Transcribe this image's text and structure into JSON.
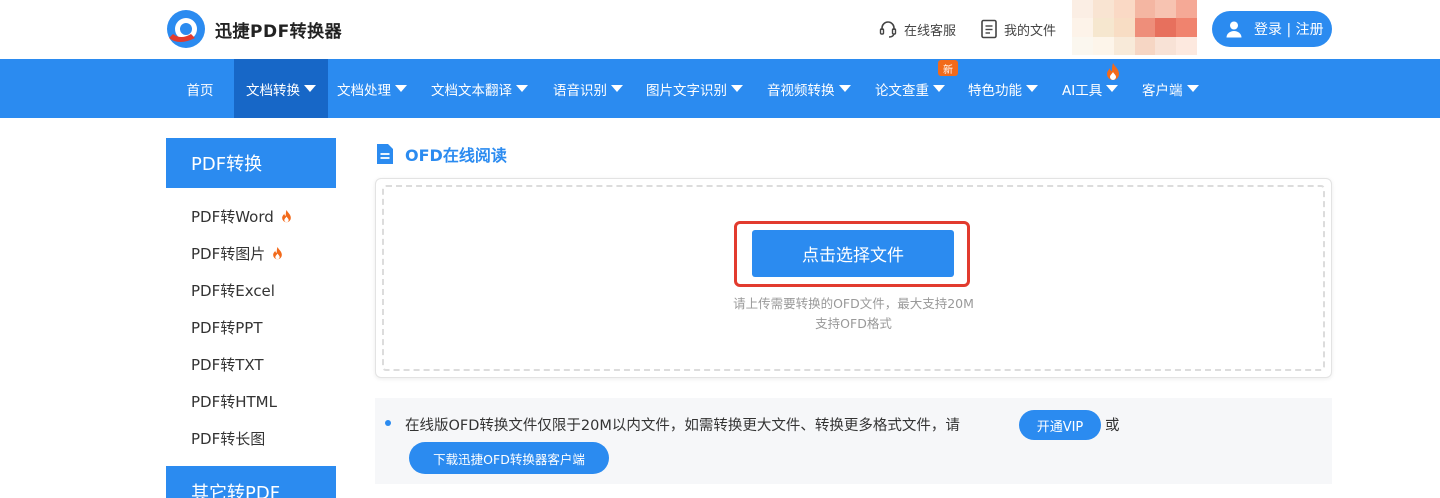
{
  "header": {
    "logo_text": "迅捷PDF转换器",
    "service_label": "在线客服",
    "files_label": "我的文件",
    "login_label": "登录 | 注册"
  },
  "nav": {
    "items": [
      {
        "label": "首页",
        "has_caret": false,
        "active": false
      },
      {
        "label": "文档转换",
        "has_caret": true,
        "active": true
      },
      {
        "label": "文档处理",
        "has_caret": true,
        "active": false
      },
      {
        "label": "文档文本翻译",
        "has_caret": true,
        "active": false
      },
      {
        "label": "语音识别",
        "has_caret": true,
        "active": false
      },
      {
        "label": "图片文字识别",
        "has_caret": true,
        "active": false
      },
      {
        "label": "音视频转换",
        "has_caret": true,
        "active": false
      },
      {
        "label": "论文查重",
        "has_caret": true,
        "active": false
      },
      {
        "label": "特色功能",
        "has_caret": true,
        "active": false
      },
      {
        "label": "AI工具",
        "has_caret": true,
        "active": false
      },
      {
        "label": "客户端",
        "has_caret": true,
        "active": false
      }
    ],
    "new_badge": "新"
  },
  "sidebar": {
    "section1_title": "PDF转换",
    "items": [
      {
        "label": "PDF转Word",
        "hot": true
      },
      {
        "label": "PDF转图片",
        "hot": true
      },
      {
        "label": "PDF转Excel",
        "hot": false
      },
      {
        "label": "PDF转PPT",
        "hot": false
      },
      {
        "label": "PDF转TXT",
        "hot": false
      },
      {
        "label": "PDF转HTML",
        "hot": false
      },
      {
        "label": "PDF转长图",
        "hot": false
      }
    ],
    "section2_title": "其它转PDF"
  },
  "main": {
    "title": "OFD在线阅读",
    "select_button": "点击选择文件",
    "hint_line1": "请上传需要转换的OFD文件，最大支持20M",
    "hint_line2": "支持OFD格式",
    "notice_text": "在线版OFD转换文件仅限于20M以内文件，如需转换更大文件、转换更多格式文件，请",
    "vip_button": "开通VIP",
    "or_text": "或",
    "download_button": "下载迅捷OFD转换器客户端"
  },
  "colors": {
    "primary": "#2b8bf0",
    "nav_active": "#1767c7",
    "highlight_frame": "#e23b2e",
    "hot_icon": "#f26a1b"
  }
}
